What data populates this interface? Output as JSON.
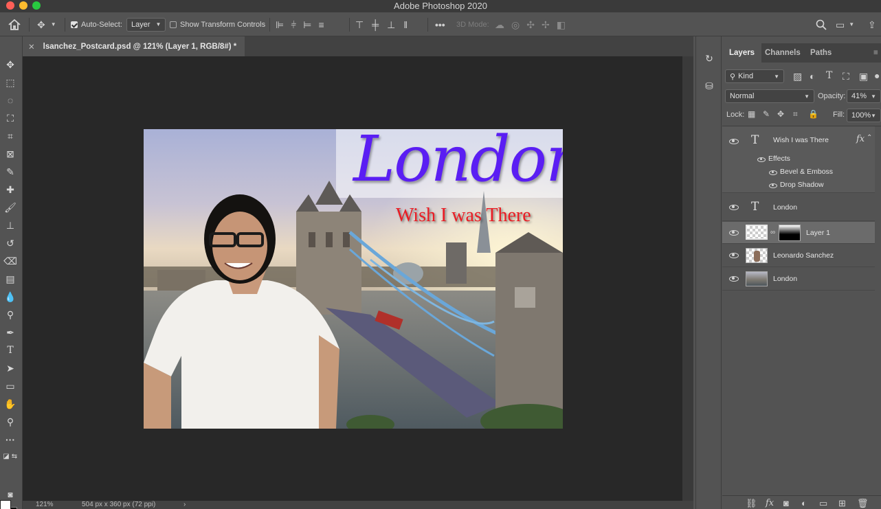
{
  "window": {
    "app_title": "Adobe Photoshop 2020"
  },
  "options_bar": {
    "auto_select_label": "Auto-Select:",
    "auto_select_checked": true,
    "auto_select_target": "Layer",
    "show_transform_label": "Show Transform Controls",
    "show_transform_checked": false,
    "mode_3d_label": "3D Mode:"
  },
  "document": {
    "tab_title": "lsanchez_Postcard.psd @ 121% (Layer 1, RGB/8#) *",
    "zoom": "121%",
    "doc_info": "504 px x 360 px (72 ppi)",
    "status_arrow": "›"
  },
  "image": {
    "headline": "London",
    "subline": "Wish I was There"
  },
  "layers_panel": {
    "tabs": [
      "Layers",
      "Channels",
      "Paths"
    ],
    "active_tab": "Layers",
    "filter_kind": "Kind",
    "blend_mode": "Normal",
    "opacity_label": "Opacity:",
    "opacity_value": "41%",
    "lock_label": "Lock:",
    "fill_label": "Fill:",
    "fill_value": "100%",
    "layers": [
      {
        "name": "Wish I was There",
        "type": "text",
        "fx": "fx"
      },
      {
        "name": "London",
        "type": "text"
      },
      {
        "name": "Layer 1",
        "type": "pixel",
        "selected": true
      },
      {
        "name": "Leonardo Sanchez",
        "type": "pixel"
      },
      {
        "name": "London",
        "type": "pixel"
      }
    ],
    "effects_label": "Effects",
    "effects": [
      "Bevel & Emboss",
      "Drop Shadow"
    ]
  },
  "colors": {
    "headline": "#5a1ef3",
    "subline": "#ea1c24",
    "foreground": "#ffffff",
    "background": "#000000"
  }
}
